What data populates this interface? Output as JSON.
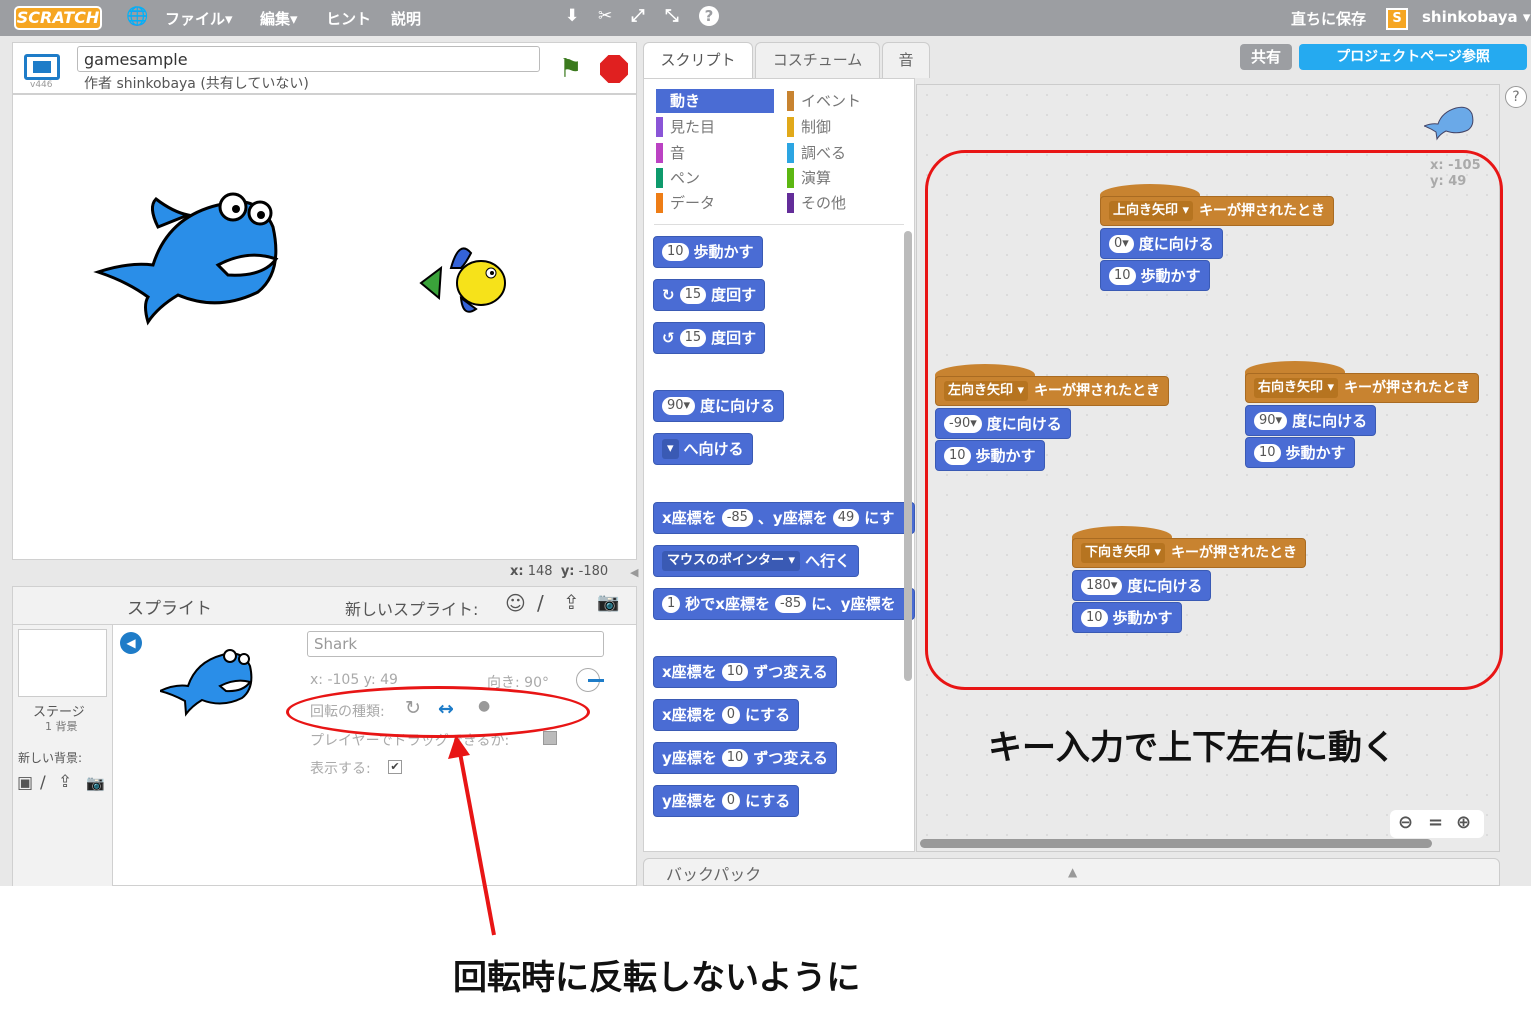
{
  "menubar": {
    "logo": "SCRATCH",
    "items": [
      "ファイル▾",
      "編集▾",
      "ヒント",
      "説明"
    ],
    "save_now": "直ちに保存",
    "user": "shinkobaya ▾"
  },
  "stage": {
    "title": "gamesample",
    "author": "作者 shinkobaya (共有していない)",
    "version": "v446",
    "coords_x_label": "x:",
    "coords_x": "148",
    "coords_y_label": "y:",
    "coords_y": "-180"
  },
  "sprites": {
    "header": "スプライト",
    "new_sprite": "新しいスプライト:",
    "stage_label": "ステージ",
    "stage_backdrops": "1 背景",
    "new_backdrop": "新しい背景:",
    "name_value": "Shark",
    "pos": "x: -105  y: 49",
    "direction": "向き: 90°",
    "rotation_style": "回転の種類:",
    "draggable": "プレイヤーでドラッグできるか:",
    "show": "表示する:"
  },
  "tabs": [
    "スクリプト",
    "コスチューム",
    "音"
  ],
  "top_buttons": {
    "share": "共有",
    "project_page": "プロジェクトページ参照"
  },
  "categories": {
    "left": [
      {
        "label": "動き",
        "color": "#4a6cd4"
      },
      {
        "label": "見た目",
        "color": "#8a55d7"
      },
      {
        "label": "音",
        "color": "#bb42c3"
      },
      {
        "label": "ペン",
        "color": "#0e9a6c"
      },
      {
        "label": "データ",
        "color": "#ee7d16"
      }
    ],
    "right": [
      {
        "label": "イベント",
        "color": "#c88330"
      },
      {
        "label": "制御",
        "color": "#e1a91a"
      },
      {
        "label": "調べる",
        "color": "#2ca5e2"
      },
      {
        "label": "演算",
        "color": "#5cb712"
      },
      {
        "label": "その他",
        "color": "#632d99"
      }
    ]
  },
  "palette": {
    "move": {
      "v": "10",
      "t": "歩動かす"
    },
    "turn_right": {
      "v": "15",
      "t": "度回す"
    },
    "turn_left": {
      "v": "15",
      "t": "度回す"
    },
    "point_dir": {
      "v": "90▾",
      "t": "度に向ける"
    },
    "point_towards": {
      "t": "へ向ける"
    },
    "goto_xy": {
      "a": "x座標を",
      "x": "-85",
      "b": "、y座標を",
      "y": "49",
      "c": "にす"
    },
    "goto": {
      "v": "マウスのポインター ▾",
      "t": "へ行く"
    },
    "glide": {
      "s": "1",
      "a": "秒でx座標を",
      "x": "-85",
      "b": "に、y座標を"
    },
    "change_x": {
      "a": "x座標を",
      "v": "10",
      "t": "ずつ変える"
    },
    "set_x": {
      "a": "x座標を",
      "v": "0",
      "t": "にする"
    },
    "change_y": {
      "a": "y座標を",
      "v": "10",
      "t": "ずつ変える"
    },
    "set_y": {
      "a": "y座標を",
      "v": "0",
      "t": "にする"
    }
  },
  "scripts": {
    "sprite_x": "x: -105",
    "sprite_y": "y: 49",
    "when_key": "キーが押されたとき",
    "point": "度に向ける",
    "move": "歩動かす",
    "up": {
      "key": "上向き矢印 ▾",
      "dir": "0▾",
      "steps": "10"
    },
    "left": {
      "key": "左向き矢印 ▾",
      "dir": "-90▾",
      "steps": "10"
    },
    "right": {
      "key": "右向き矢印 ▾",
      "dir": "90▾",
      "steps": "10"
    },
    "down": {
      "key": "下向き矢印 ▾",
      "dir": "180▾",
      "steps": "10"
    }
  },
  "backpack": "バックパック",
  "annotations": {
    "caption_scripts": "キー入力で上下左右に動く",
    "caption_rotation": "回転時に反転しないように",
    "highlight_color": "#e81515"
  }
}
